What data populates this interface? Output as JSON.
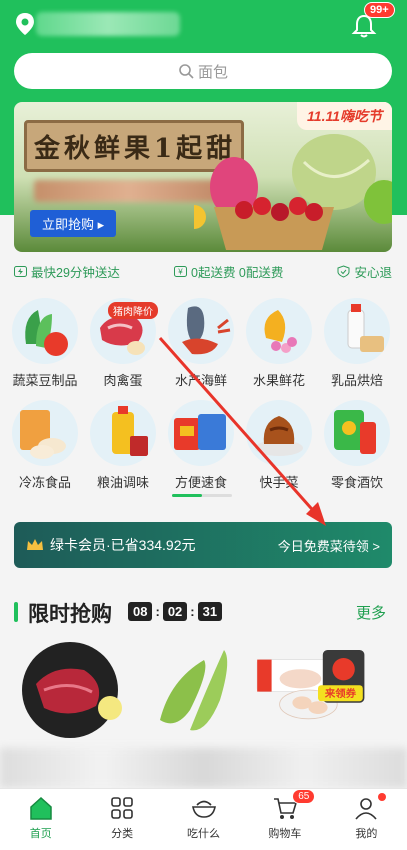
{
  "header": {
    "notifications_badge": "99+"
  },
  "search": {
    "placeholder": "面包"
  },
  "banner": {
    "title": "金秋鲜果1起甜",
    "event_tag": "11.11嗨吃节",
    "cta_label": "立即抢购 ▸"
  },
  "service_badges": [
    {
      "icon": "lightning-icon",
      "label": "最快29分钟送达"
    },
    {
      "icon": "coin-icon",
      "label": "0起送费 0配送费"
    },
    {
      "icon": "shield-check-icon",
      "label": "安心退"
    }
  ],
  "categories": [
    {
      "label": "蔬菜豆制品",
      "icon": "vegetables-icon"
    },
    {
      "label": "肉禽蛋",
      "icon": "meat-icon",
      "tag": "猪肉降价"
    },
    {
      "label": "水产海鲜",
      "icon": "seafood-icon"
    },
    {
      "label": "水果鲜花",
      "icon": "fruit-icon"
    },
    {
      "label": "乳品烘焙",
      "icon": "dairy-icon"
    },
    {
      "label": "冷冻食品",
      "icon": "frozen-food-icon"
    },
    {
      "label": "粮油调味",
      "icon": "grain-oil-icon"
    },
    {
      "label": "方便速食",
      "icon": "instant-food-icon"
    },
    {
      "label": "快手菜",
      "icon": "quick-dish-icon"
    },
    {
      "label": "零食酒饮",
      "icon": "snacks-drinks-icon"
    }
  ],
  "vip": {
    "left_text": "绿卡会员·已省334.92元",
    "right_text": "今日免费菜待领 >"
  },
  "flash_sale": {
    "title": "限时抢购",
    "timer": [
      "08",
      "02",
      "31"
    ],
    "more_label": "更多",
    "coupon_label": "来领券"
  },
  "tabbar": [
    {
      "label": "首页",
      "icon": "home-icon",
      "active": true
    },
    {
      "label": "分类",
      "icon": "category-icon"
    },
    {
      "label": "吃什么",
      "icon": "bowl-icon"
    },
    {
      "label": "购物车",
      "icon": "cart-icon",
      "badge": "65"
    },
    {
      "label": "我的",
      "icon": "profile-icon"
    }
  ],
  "colors": {
    "brand_green": "#20c05c",
    "badge_red": "#ff3b30",
    "vip_teal": "#1e5b58"
  }
}
